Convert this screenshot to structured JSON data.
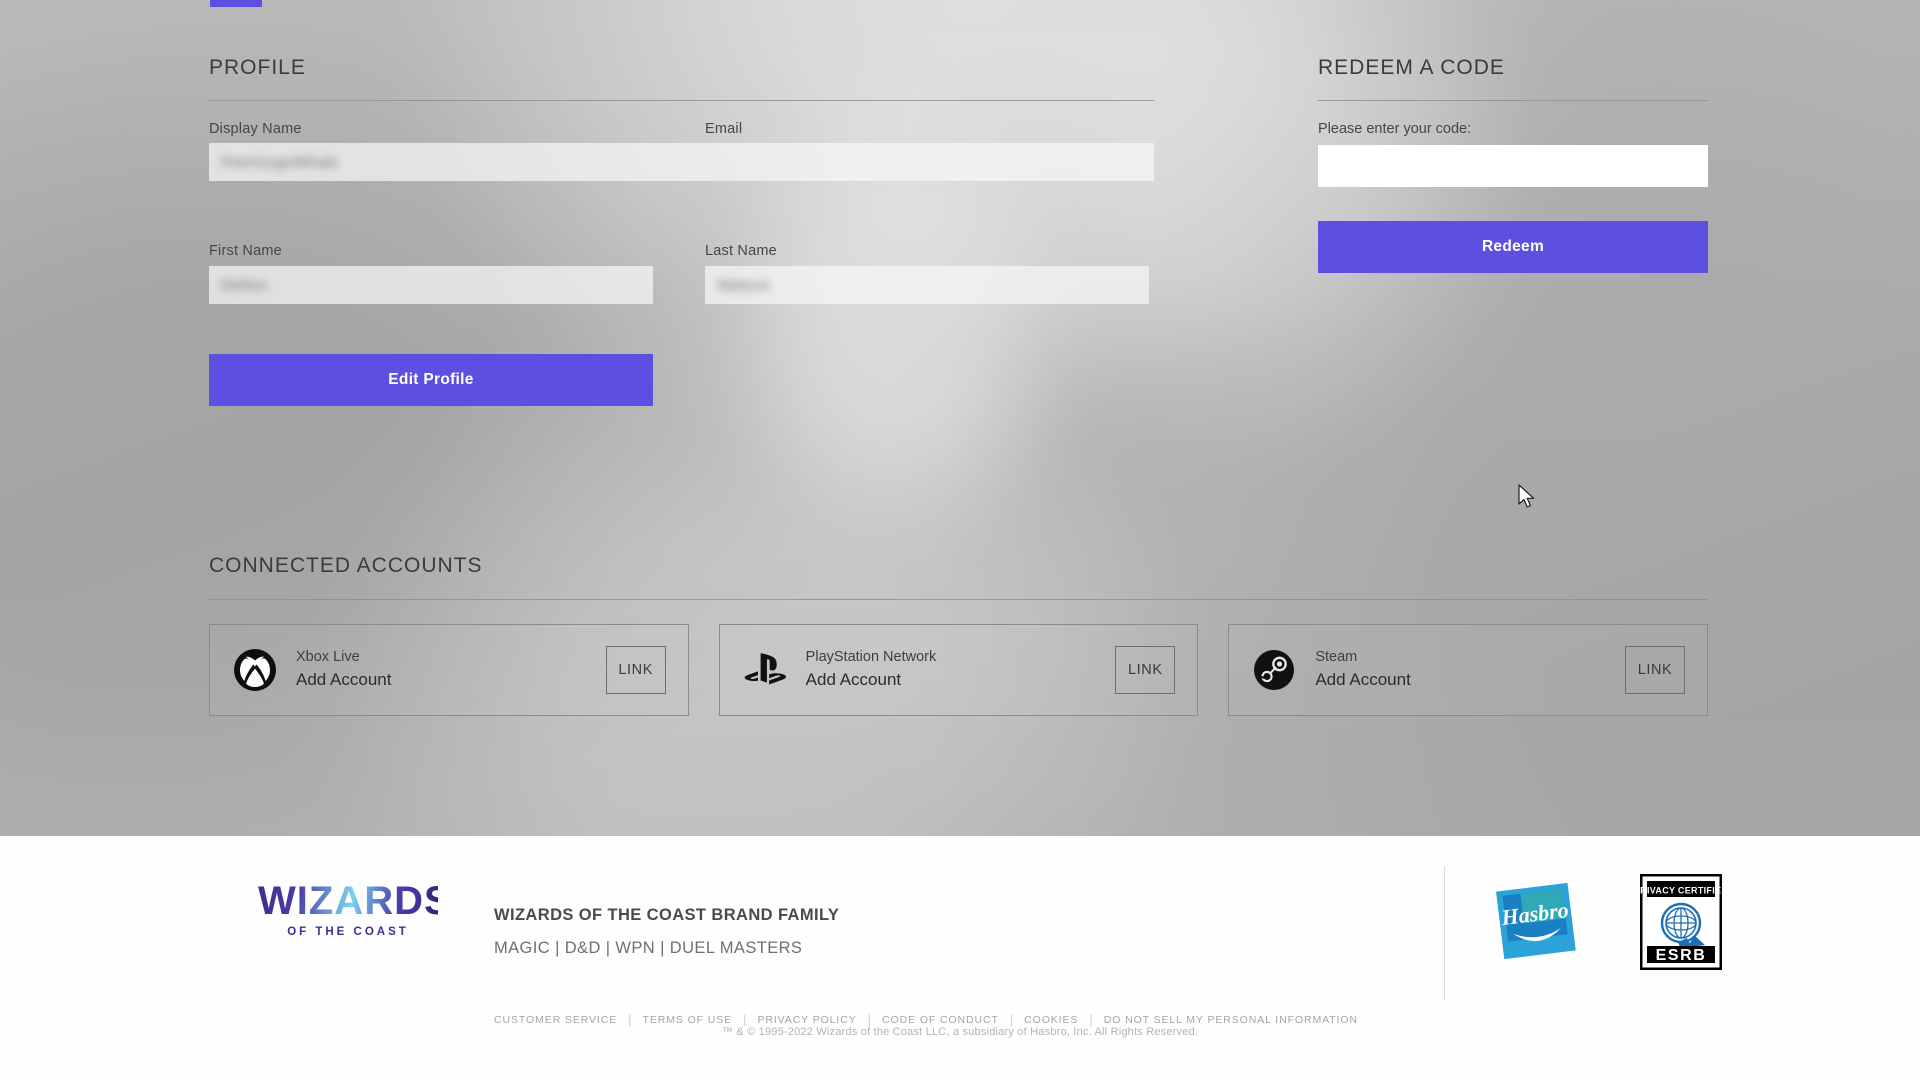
{
  "profile": {
    "title": "PROFILE",
    "fields": {
      "display_name": {
        "label": "Display Name",
        "value": "PeerGogoWhale"
      },
      "email": {
        "label": "Email",
        "value": ""
      },
      "first_name": {
        "label": "First Name",
        "value": "Delton"
      },
      "last_name": {
        "label": "Last Name",
        "value": "Watson"
      }
    },
    "edit_button": "Edit Profile"
  },
  "redeem": {
    "title": "REDEEM A CODE",
    "label": "Please enter your code:",
    "input_value": "",
    "input_placeholder": "",
    "button": "Redeem"
  },
  "connected_accounts": {
    "title": "CONNECTED ACCOUNTS",
    "cards": [
      {
        "icon": "xbox-icon",
        "service": "Xbox Live",
        "action": "Add Account",
        "button": "LINK"
      },
      {
        "icon": "playstation-icon",
        "service": "PlayStation Network",
        "action": "Add Account",
        "button": "LINK"
      },
      {
        "icon": "steam-icon",
        "service": "Steam",
        "action": "Add Account",
        "button": "LINK"
      }
    ]
  },
  "footer": {
    "logo": {
      "word": "WIZARDS",
      "sub": "OF THE COAST"
    },
    "brand_title": "WIZARDS OF THE COAST BRAND FAMILY",
    "brand_list": "MAGIC | D&D | WPN | DUEL MASTERS",
    "links": [
      "CUSTOMER SERVICE",
      "TERMS OF USE",
      "PRIVACY POLICY",
      "CODE OF CONDUCT",
      "COOKIES",
      "DO NOT SELL MY PERSONAL INFORMATION"
    ],
    "badges": [
      {
        "name": "hasbro-logo",
        "label": "Hasbro"
      },
      {
        "name": "esrb-privacy-certified-badge",
        "top_label": "PRIVACY CERTIFIED",
        "bottom_label": "ESRB"
      }
    ],
    "copyright": "™ & © 1995-2022 Wizards of the Coast LLC, a subsidiary of Hasbro, Inc. All Rights Reserved."
  },
  "colors": {
    "accent": "#5d4fe0",
    "hasbro_blue": "#1b8ad4",
    "logo_gradient_start": "#3b2f8f",
    "logo_gradient_mid": "#7ad3ef"
  }
}
